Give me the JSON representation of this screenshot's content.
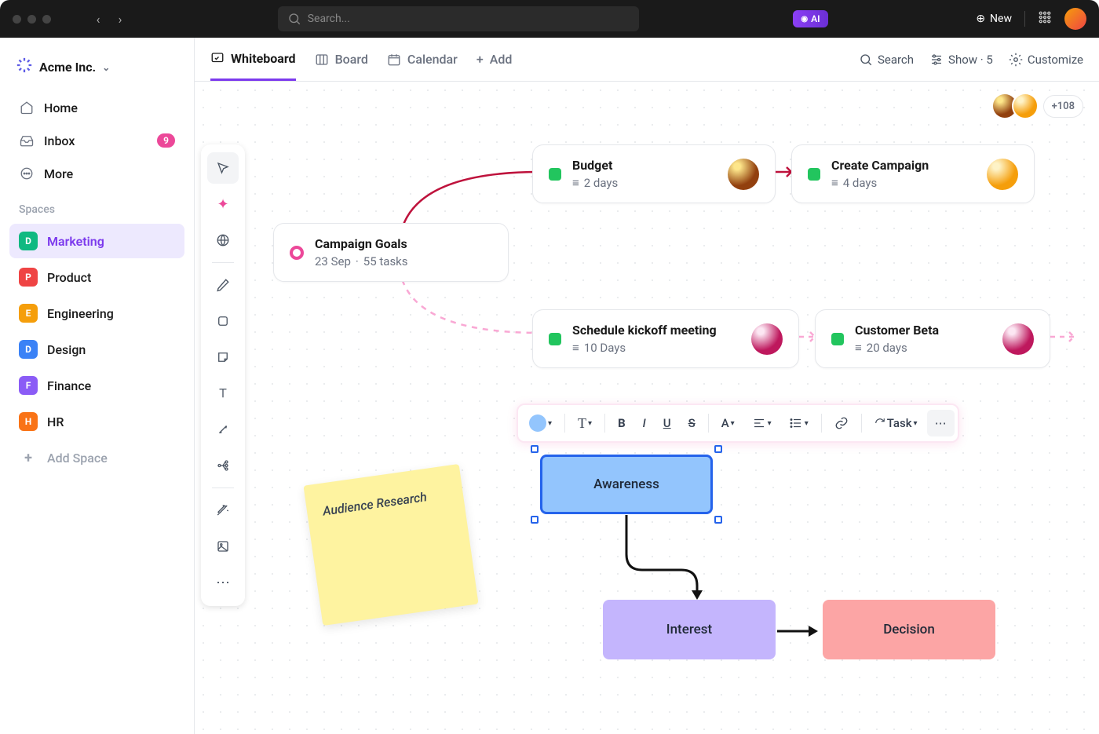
{
  "titlebar": {
    "search_placeholder": "Search...",
    "ai_label": "AI",
    "new_label": "New"
  },
  "sidebar": {
    "workspace": "Acme Inc.",
    "nav": [
      {
        "icon": "home",
        "label": "Home"
      },
      {
        "icon": "inbox",
        "label": "Inbox",
        "badge": "9"
      },
      {
        "icon": "more",
        "label": "More"
      }
    ],
    "spaces_header": "Spaces",
    "spaces": [
      {
        "letter": "D",
        "label": "Marketing",
        "color": "#10b981",
        "active": true
      },
      {
        "letter": "P",
        "label": "Product",
        "color": "#ef4444"
      },
      {
        "letter": "E",
        "label": "Engineering",
        "color": "#f59e0b"
      },
      {
        "letter": "D",
        "label": "Design",
        "color": "#3b82f6"
      },
      {
        "letter": "F",
        "label": "Finance",
        "color": "#8b5cf6"
      },
      {
        "letter": "H",
        "label": "HR",
        "color": "#f97316"
      }
    ],
    "add_space_label": "Add Space"
  },
  "tabs": {
    "items": [
      {
        "icon": "whiteboard",
        "label": "Whiteboard",
        "active": true
      },
      {
        "icon": "board",
        "label": "Board"
      },
      {
        "icon": "calendar",
        "label": "Calendar"
      },
      {
        "icon": "add",
        "label": "Add"
      }
    ],
    "right": {
      "search": "Search",
      "show": "Show · 5",
      "customize": "Customize"
    }
  },
  "cards": {
    "goals": {
      "title": "Campaign Goals",
      "date": "23 Sep",
      "tasks": "55 tasks"
    },
    "budget": {
      "title": "Budget",
      "meta": "2 days",
      "status": "#22c55e"
    },
    "campaign": {
      "title": "Create Campaign",
      "meta": "4 days",
      "status": "#22c55e"
    },
    "kickoff": {
      "title": "Schedule kickoff meeting",
      "meta": "10 Days",
      "status": "#22c55e"
    },
    "beta": {
      "title": "Customer Beta",
      "meta": "20 days",
      "status": "#22c55e"
    }
  },
  "sticky": {
    "text": "Audience Research"
  },
  "flow": {
    "awareness": "Awareness",
    "interest": "Interest",
    "decision": "Decision"
  },
  "format_bar": {
    "task_label": "Task"
  },
  "avatars": {
    "more": "+108"
  }
}
